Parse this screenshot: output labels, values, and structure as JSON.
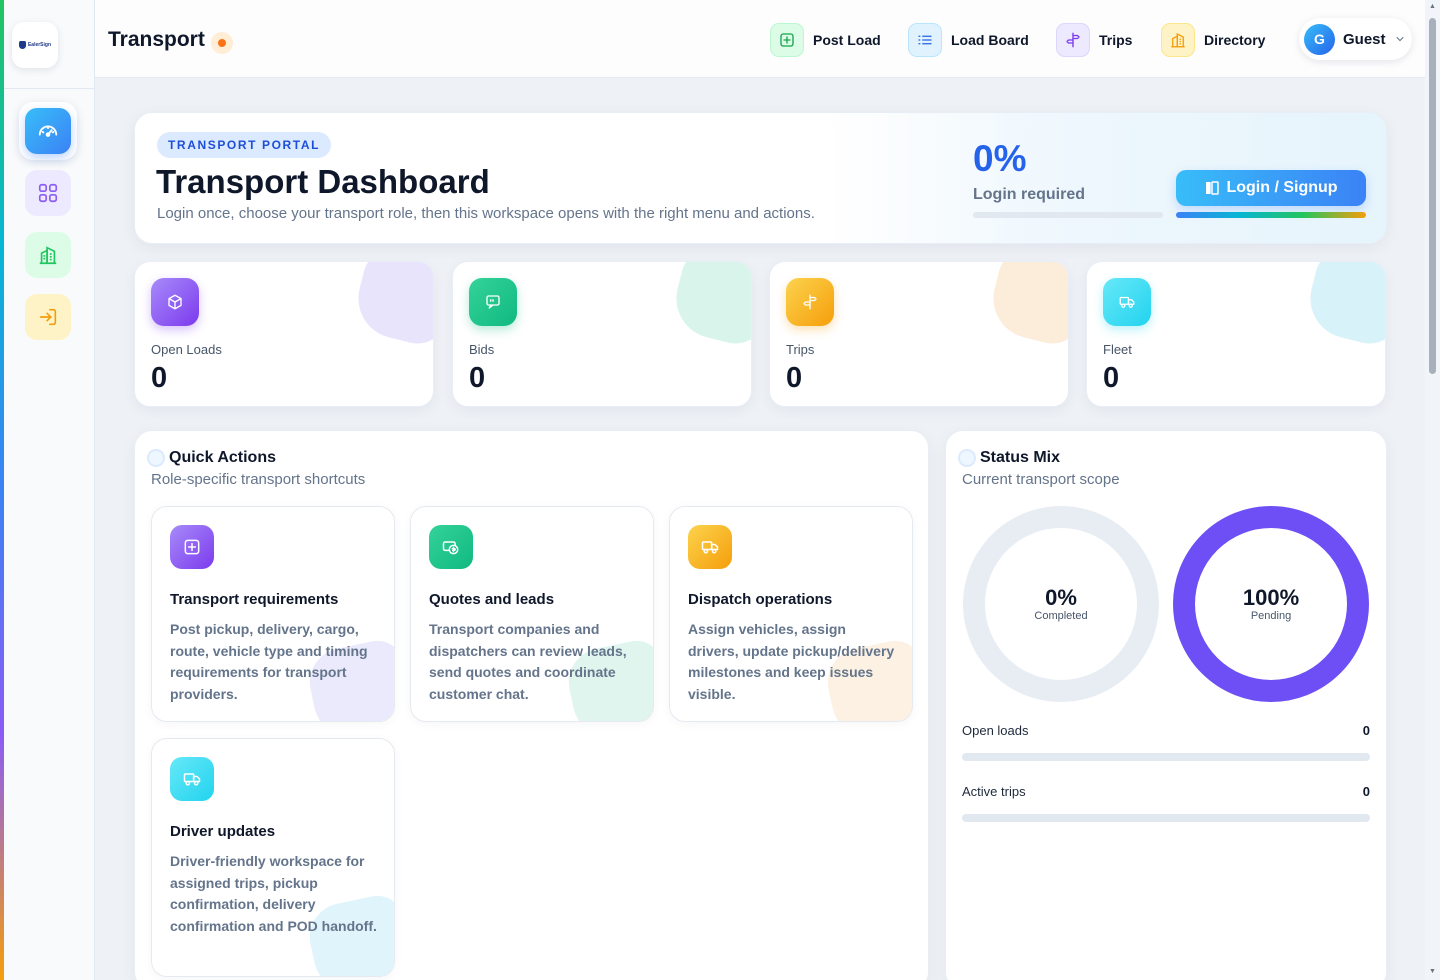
{
  "app": {
    "title": "Transport",
    "logo_text": "EalerSign"
  },
  "nav": [
    {
      "label": "Post Load",
      "icon": "plus-square-icon",
      "color": "#16a34a"
    },
    {
      "label": "Load Board",
      "icon": "list-icon",
      "color": "#2563eb"
    },
    {
      "label": "Trips",
      "icon": "signpost-icon",
      "color": "#7c3aed"
    },
    {
      "label": "Directory",
      "icon": "building-icon",
      "color": "#f59e0b"
    }
  ],
  "user": {
    "initial": "G",
    "name": "Guest"
  },
  "hero": {
    "badge": "TRANSPORT PORTAL",
    "title": "Transport Dashboard",
    "subtitle": "Login once, choose your transport role, then this workspace opens with the right menu and actions.",
    "percent": "0%",
    "status": "Login required",
    "login_label": "Login / Signup"
  },
  "stats": [
    {
      "label": "Open Loads",
      "value": "0",
      "icon": "box-icon",
      "color": "#8b5cf6"
    },
    {
      "label": "Bids",
      "value": "0",
      "icon": "chat-icon",
      "color": "#10b981"
    },
    {
      "label": "Trips",
      "value": "0",
      "icon": "signpost-icon",
      "color": "#f59e0b"
    },
    {
      "label": "Fleet",
      "value": "0",
      "icon": "truck-icon",
      "color": "#22d3ee"
    }
  ],
  "quick_actions": {
    "title": "Quick Actions",
    "subtitle": "Role-specific transport shortcuts",
    "items": [
      {
        "title": "Transport requirements",
        "description": "Post pickup, delivery, cargo, route, vehicle type and timing requirements for transport providers.",
        "icon": "plus-square-icon"
      },
      {
        "title": "Quotes and leads",
        "description": "Transport companies and dispatchers can review leads, send quotes and coordinate customer chat.",
        "icon": "money-icon"
      },
      {
        "title": "Dispatch operations",
        "description": "Assign vehicles, assign drivers, update pickup/delivery milestones and keep issues visible.",
        "icon": "truck-icon"
      },
      {
        "title": "Driver updates",
        "description": "Driver-friendly workspace for assigned trips, pickup confirmation, delivery confirmation and POD handoff.",
        "icon": "truck-icon"
      }
    ]
  },
  "status_mix": {
    "title": "Status Mix",
    "subtitle": "Current transport scope",
    "completed": {
      "percent": "0%",
      "label": "Completed",
      "fraction": 0
    },
    "pending": {
      "percent": "100%",
      "label": "Pending",
      "fraction": 1
    },
    "metrics": [
      {
        "label": "Open loads",
        "value": "0",
        "fraction": 0
      },
      {
        "label": "Active trips",
        "value": "0",
        "fraction": 0
      }
    ]
  }
}
